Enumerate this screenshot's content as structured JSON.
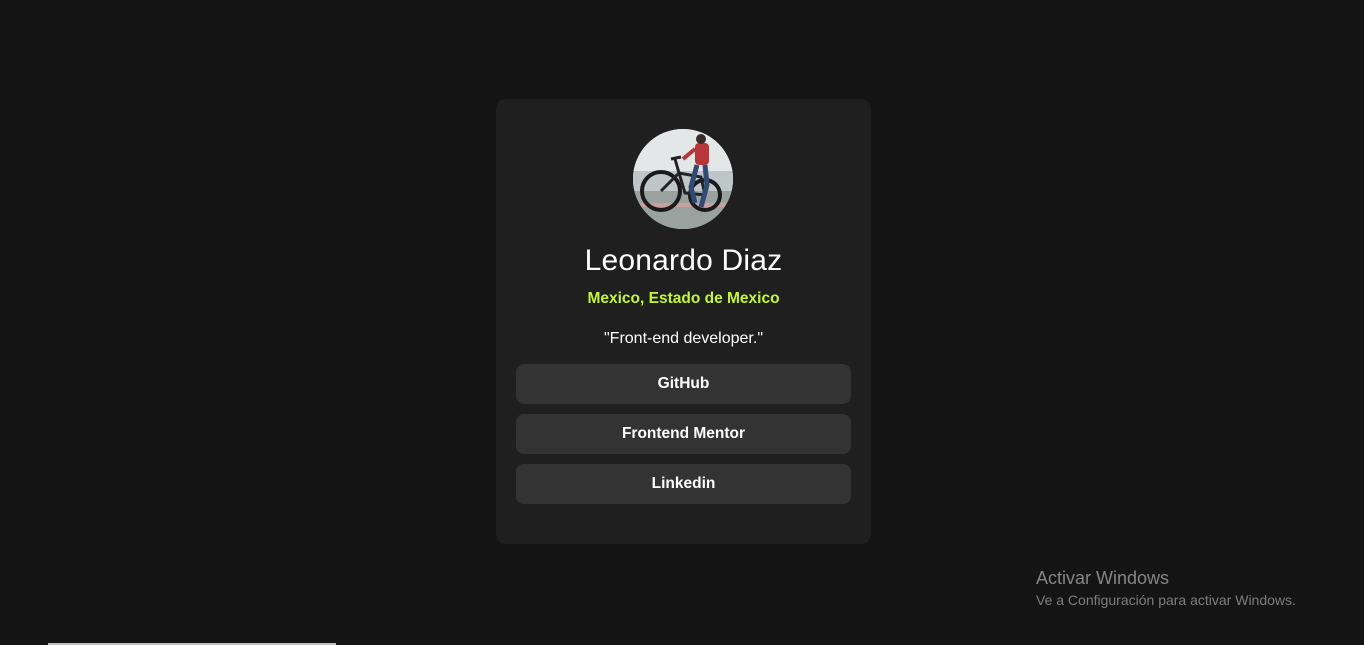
{
  "profile": {
    "avatar_icon": "profile-photo-person-with-bicycle",
    "name": "Leonardo Diaz",
    "location": "Mexico, Estado de Mexico",
    "bio": "\"Front-end developer.\""
  },
  "links": [
    {
      "label": "GitHub"
    },
    {
      "label": "Frontend Mentor"
    },
    {
      "label": "Linkedin"
    }
  ],
  "watermark": {
    "title": "Activar Windows",
    "subtitle": "Ve a Configuración para activar Windows."
  },
  "colors": {
    "background": "#141414",
    "card": "#1f1f1f",
    "button": "#333333",
    "accent": "#c4f82a",
    "text": "#ffffff"
  }
}
